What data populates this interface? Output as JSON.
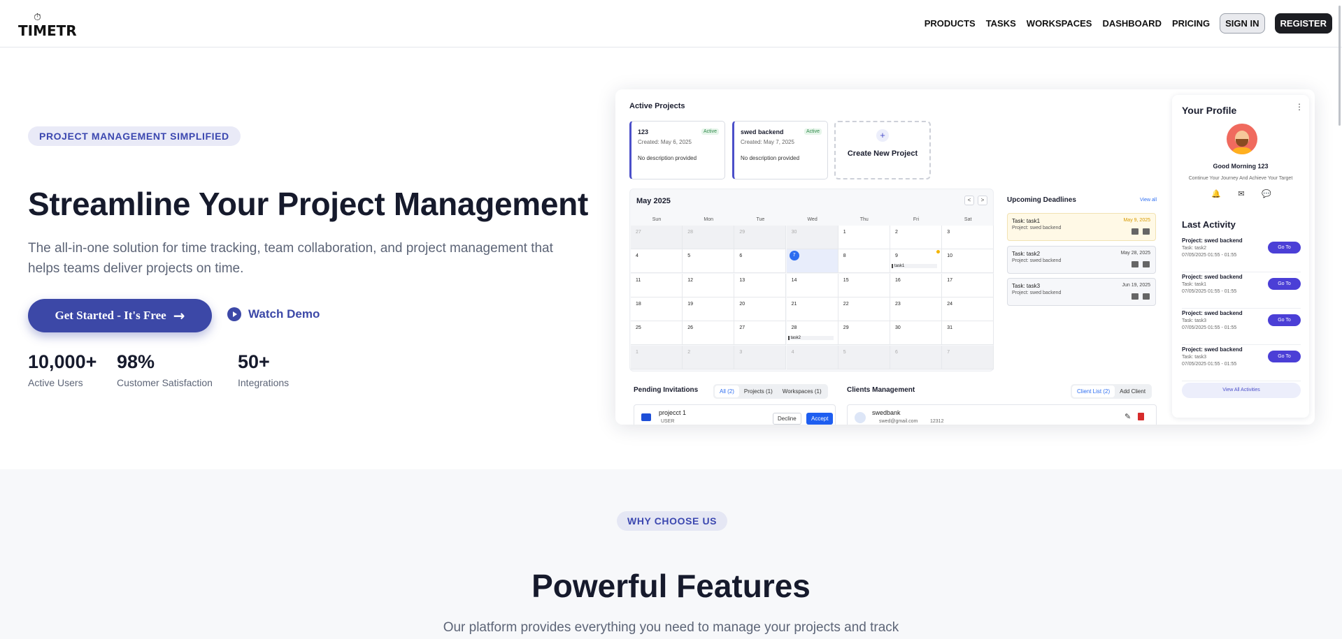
{
  "nav": {
    "logo": "TIMETR",
    "links": [
      "PRODUCTS",
      "TASKS",
      "WORKSPACES",
      "DASHBOARD",
      "PRICING"
    ],
    "signin": "SIGN IN",
    "register": "REGISTER"
  },
  "hero": {
    "pill": "PROJECT MANAGEMENT SIMPLIFIED",
    "title": "Streamline Your Project Management",
    "subtitle": "The all-in-one solution for time tracking, team collaboration, and project management that helps teams deliver projects on time.",
    "cta": "Get Started - It's Free",
    "watch": "Watch Demo",
    "stats": [
      {
        "value": "10,000+",
        "label": "Active Users"
      },
      {
        "value": "98%",
        "label": "Customer Satisfaction"
      },
      {
        "value": "50+",
        "label": "Integrations"
      }
    ]
  },
  "dashboard": {
    "active_projects": "Active Projects",
    "projects": [
      {
        "title": "123",
        "badge": "Active",
        "created": "Created: May 6, 2025",
        "desc": "No description provided"
      },
      {
        "title": "swed backend",
        "badge": "Active",
        "created": "Created: May 7, 2025",
        "desc": "No description provided"
      }
    ],
    "new_project": "Create New Project",
    "calendar": {
      "month": "May 2025",
      "prev": "<",
      "next": ">",
      "dow": [
        "Sun",
        "Mon",
        "Tue",
        "Wed",
        "Thu",
        "Fri",
        "Sat"
      ],
      "weeks": [
        [
          "27",
          "28",
          "29",
          "30",
          "1",
          "2",
          "3"
        ],
        [
          "4",
          "5",
          "6",
          "7",
          "8",
          "9",
          "10"
        ],
        [
          "11",
          "12",
          "13",
          "14",
          "15",
          "16",
          "17"
        ],
        [
          "18",
          "19",
          "20",
          "21",
          "22",
          "23",
          "24"
        ],
        [
          "25",
          "26",
          "27",
          "28",
          "29",
          "30",
          "31"
        ],
        [
          "1",
          "2",
          "3",
          "4",
          "5",
          "6",
          "7"
        ]
      ],
      "task1": "task1",
      "task2": "task2"
    },
    "upcoming": {
      "title": "Upcoming Deadlines",
      "view_all": "View all",
      "items": [
        {
          "task": "Task: task1",
          "project": "Project: swed backend",
          "date": "May 9, 2025"
        },
        {
          "task": "Task: task2",
          "project": "Project: swed backend",
          "date": "May 28, 2025"
        },
        {
          "task": "Task: task3",
          "project": "Project: swed backend",
          "date": "Jun 19, 2025"
        }
      ]
    },
    "profile": {
      "title": "Your Profile",
      "greeting": "Good Morning 123",
      "sub": "Continue Your Journey And Achieve Your Target",
      "last_activity": "Last Activity",
      "go": "Go To",
      "activities": [
        {
          "project": "Project: swed backend",
          "task": "Task: task2",
          "time": "07/05/2025 01:55 - 01:55"
        },
        {
          "project": "Project: swed backend",
          "task": "Task: task1",
          "time": "07/05/2025 01:55 - 01:55"
        },
        {
          "project": "Project: swed backend",
          "task": "Task: task3",
          "time": "07/05/2025 01:55 - 01:55"
        },
        {
          "project": "Project: swed backend",
          "task": "Task: task3",
          "time": "07/05/2025 01:55 - 01:55"
        }
      ],
      "view_all": "View All Activities"
    },
    "invitations": {
      "title": "Pending Invitations",
      "tabs": [
        "All (2)",
        "Projects (1)",
        "Workspaces (1)"
      ],
      "item": {
        "name": "projecct 1",
        "role": "USER",
        "decline": "Decline",
        "accept": "Accept"
      }
    },
    "clients": {
      "title": "Clients Management",
      "tabs": [
        "Client List (2)",
        "Add Client"
      ],
      "item": {
        "name": "swedbank",
        "email": "swed@gmail.com",
        "phone": "12312"
      }
    }
  },
  "features": {
    "pill": "WHY CHOOSE US",
    "title": "Powerful Features",
    "sub": "Our platform provides everything you need to manage your projects and track"
  }
}
